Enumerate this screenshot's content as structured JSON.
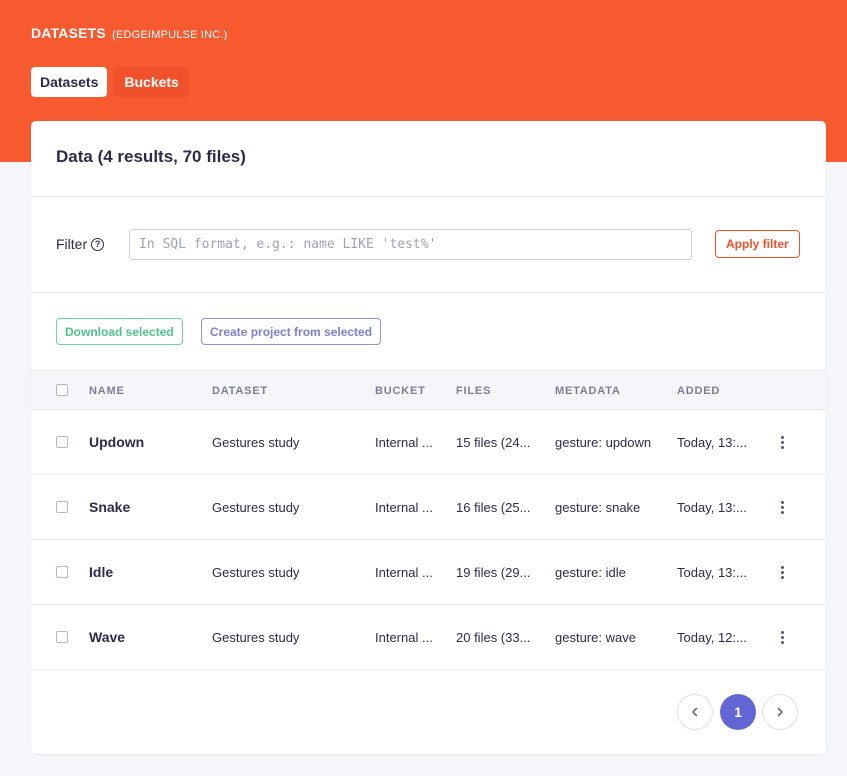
{
  "header": {
    "title": "DATASETS",
    "org": "(EDGEIMPULSE INC.)",
    "tabs": [
      {
        "label": "Datasets",
        "active": true
      },
      {
        "label": "Buckets",
        "active": false
      }
    ],
    "accent_color": "#f85a30"
  },
  "card": {
    "title": "Data (4 results, 70 files)"
  },
  "filter": {
    "label": "Filter",
    "help_icon": "question-circle-icon",
    "value": "",
    "placeholder": "In SQL format, e.g.: name LIKE 'test%'",
    "apply_label": "Apply filter"
  },
  "actions": {
    "download_label": "Download selected",
    "create_project_label": "Create project from selected"
  },
  "table": {
    "columns": [
      "NAME",
      "DATASET",
      "BUCKET",
      "FILES",
      "METADATA",
      "ADDED"
    ],
    "rows": [
      {
        "name": "Updown",
        "dataset": "Gestures study",
        "bucket": "Internal ...",
        "files": "15 files (24...",
        "metadata": "gesture: updown",
        "added": "Today, 13:..."
      },
      {
        "name": "Snake",
        "dataset": "Gestures study",
        "bucket": "Internal ...",
        "files": "16 files (25...",
        "metadata": "gesture: snake",
        "added": "Today, 13:..."
      },
      {
        "name": "Idle",
        "dataset": "Gestures study",
        "bucket": "Internal ...",
        "files": "19 files (29...",
        "metadata": "gesture: idle",
        "added": "Today, 13:..."
      },
      {
        "name": "Wave",
        "dataset": "Gestures study",
        "bucket": "Internal ...",
        "files": "20 files (33...",
        "metadata": "gesture: wave",
        "added": "Today, 12:..."
      }
    ]
  },
  "pagination": {
    "current_page": "1",
    "prev_icon": "chevron-left-icon",
    "next_icon": "chevron-right-icon"
  }
}
